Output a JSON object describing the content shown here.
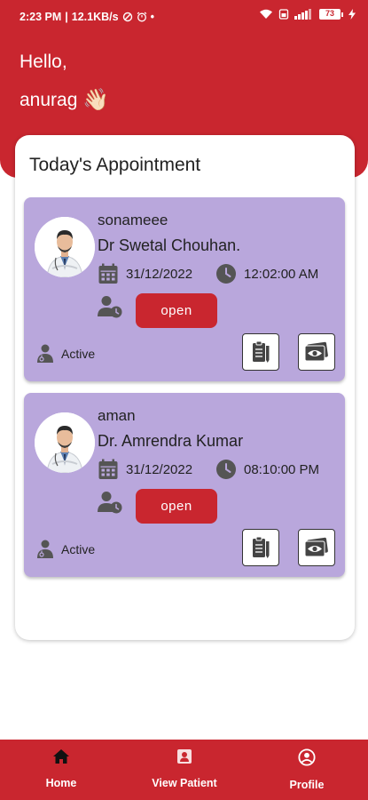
{
  "status_bar": {
    "time": "2:23 PM",
    "speed": "12.1KB/s",
    "battery": "73"
  },
  "header": {
    "greeting": "Hello,",
    "username": "anurag",
    "emoji": "👋🏻"
  },
  "panel": {
    "title": "Today's Appointment"
  },
  "appointments": [
    {
      "patient": "sonameee",
      "doctor": "Dr Swetal Chouhan.",
      "date": "31/12/2022",
      "time": "12:02:00 AM",
      "button": "open",
      "status": "Active"
    },
    {
      "patient": "aman",
      "doctor": "Dr. Amrendra Kumar",
      "date": "31/12/2022",
      "time": "08:10:00 PM",
      "button": "open",
      "status": "Active"
    }
  ],
  "nav": {
    "home": "Home",
    "view_patient": "View Patient",
    "profile": "Profile"
  },
  "colors": {
    "primary": "#c9262f",
    "card": "#b9a7dc"
  }
}
